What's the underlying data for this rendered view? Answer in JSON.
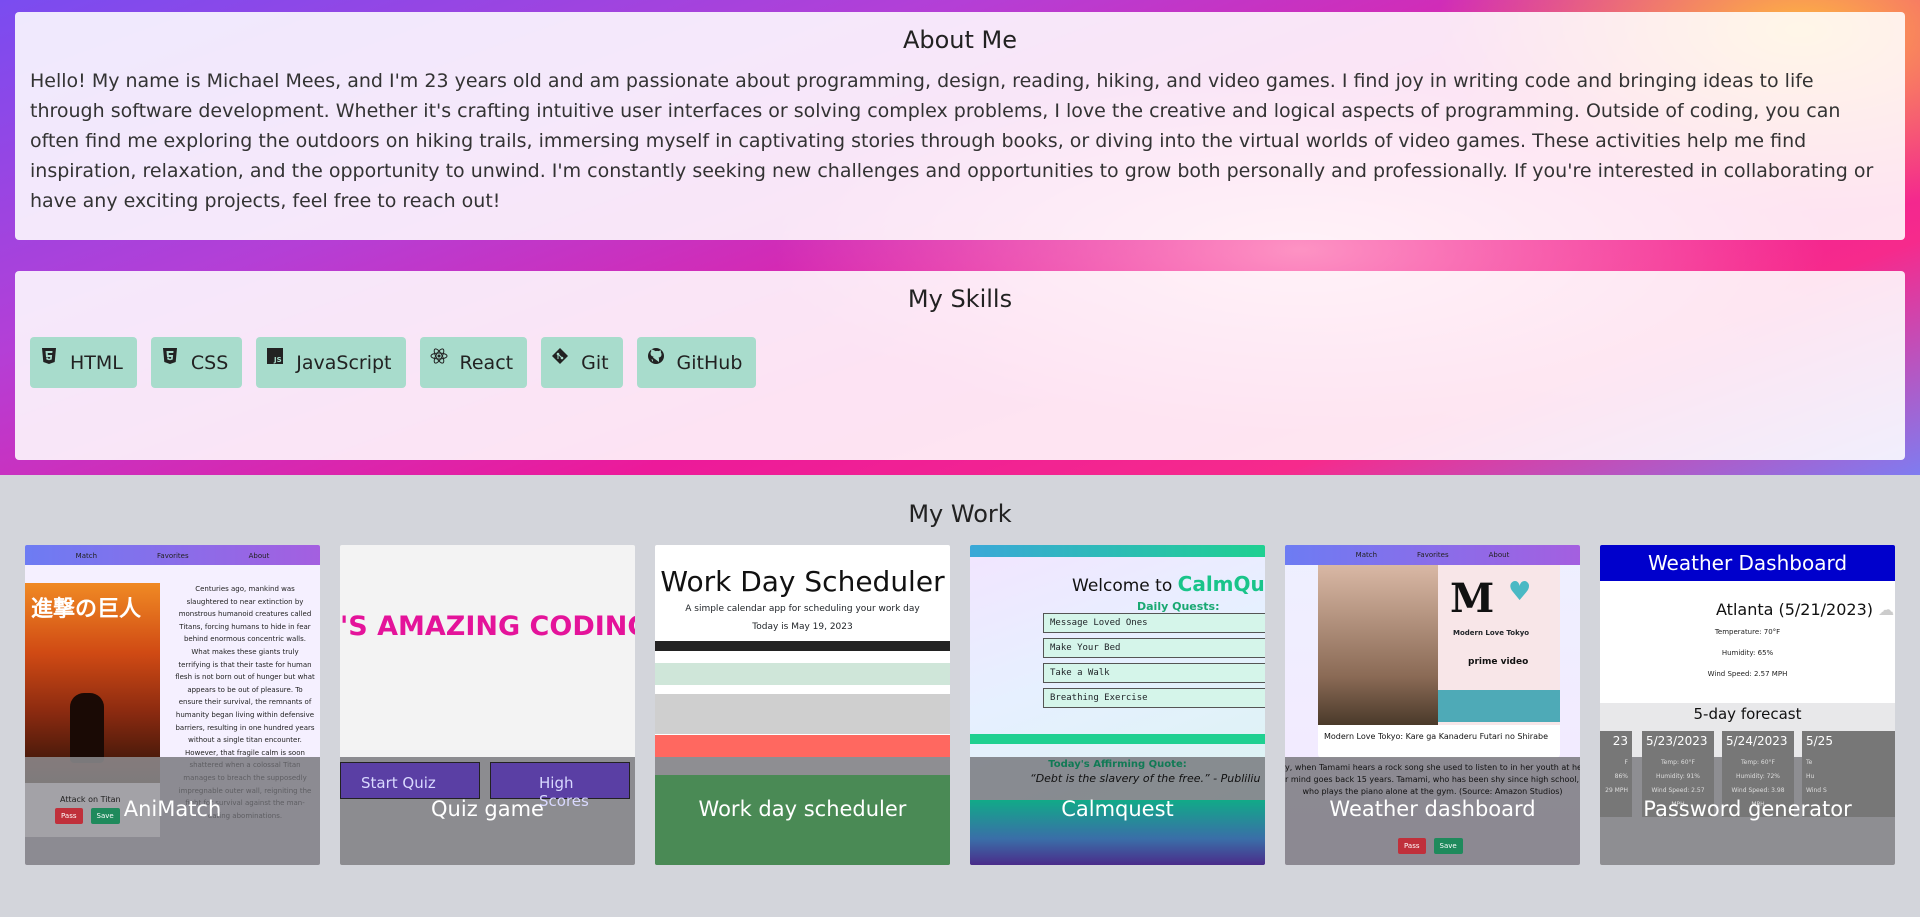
{
  "about": {
    "title": "About Me",
    "body": "Hello! My name is Michael Mees, and I'm 23 years old and am passionate about programming, design, reading, hiking, and video games. I find joy in writing code and bringing ideas to life through software development. Whether it's crafting intuitive user interfaces or solving complex problems, I love the creative and logical aspects of programming. Outside of coding, you can often find me exploring the outdoors on hiking trails, immersing myself in captivating stories through books, or diving into the virtual worlds of video games. These activities help me find inspiration, relaxation, and the opportunity to unwind. I'm constantly seeking new challenges and opportunities to grow both personally and professionally. If you're interested in collaborating or have any exciting projects, feel free to reach out!"
  },
  "skills": {
    "title": "My Skills",
    "items": [
      {
        "label": "HTML",
        "icon": "html5-icon"
      },
      {
        "label": "CSS",
        "icon": "css3-icon"
      },
      {
        "label": "JavaScript",
        "icon": "javascript-icon"
      },
      {
        "label": "React",
        "icon": "react-icon"
      },
      {
        "label": "Git",
        "icon": "git-icon"
      },
      {
        "label": "GitHub",
        "icon": "github-icon"
      }
    ]
  },
  "work": {
    "title": "My Work",
    "cards": [
      {
        "title": "AniMatch",
        "nav": [
          "Match",
          "Favorites",
          "About"
        ],
        "poster_text": "進撃の巨人",
        "caption": "Attack on Titan",
        "description": "Centuries ago, mankind was slaughtered to near extinction by monstrous humanoid creatures called Titans, forcing humans to hide in fear behind enormous concentric walls. What makes these giants truly terrifying is that their taste for human flesh is not born out of hunger but what appears to be out of pleasure. To ensure their survival, the remnants of humanity began living within defensive barriers, resulting in one hundred years without a single titan encounter. However, that fragile calm is soon shattered when a colossal Titan manages to breach the supposedly impregnable outer wall, reigniting the fight for survival against the man-eating abominations.",
        "pass": "Pass",
        "save": "Save"
      },
      {
        "title": "Quiz game",
        "marquee": "'S AMAZING CODING Q",
        "start": "Start Quiz",
        "scores": "High Scores"
      },
      {
        "title": "Work day scheduler",
        "heading": "Work Day Scheduler",
        "subtitle": "A simple calendar app for scheduling your work day",
        "today": "Today is May 19, 2023"
      },
      {
        "title": "Calmquest",
        "welcome": "Welcome to ",
        "brand": "CalmQuest",
        "daily": "Daily Quests:",
        "quests": [
          "Message Loved Ones",
          "Make Your Bed",
          "Take a Walk",
          "Breathing Exercise"
        ],
        "affirm": "Today's Affirming Quote:",
        "quote": "“Debt is the slavery of the free.” - Publiliu"
      },
      {
        "title": "Weather dashboard",
        "nav": [
          "Match",
          "Favorites",
          "About"
        ],
        "poster_m": "M",
        "poster_title": "Modern Love Tokyo",
        "poster_service": "prime video",
        "caption": "Modern Love Tokyo: Kare ga Kanaderu Futari no Shirabe",
        "story1": "y, when Tamami hears a rock song she used to listen to in her youth at he",
        "story2": "r mind goes back 15 years. Tamami, who has been shy since high school, m",
        "story3": "who plays the piano alone at the gym. (Source: Amazon Studios)",
        "pass": "Pass",
        "save": "Save"
      },
      {
        "title": "Password generator",
        "header": "Weather Dashboard",
        "city": "Atlanta (5/21/2023)",
        "temp": "Temperature: 70°F",
        "humidity": "Humidity: 65%",
        "wind": "Wind Speed: 2.57 MPH",
        "forecast_title": "5-day forecast",
        "forecast": [
          {
            "date": "23",
            "temp": "F",
            "hum": "86%",
            "wind": "29 MPH"
          },
          {
            "date": "5/23/2023",
            "temp": "Temp: 60°F",
            "hum": "Humidity: 91%",
            "wind": "Wind Speed: 2.57 MPH"
          },
          {
            "date": "5/24/2023",
            "temp": "Temp: 60°F",
            "hum": "Humidity: 72%",
            "wind": "Wind Speed: 3.98 MPH"
          },
          {
            "date": "5/25",
            "temp": "Te",
            "hum": "Hu",
            "wind": "Wind S"
          }
        ]
      }
    ]
  }
}
